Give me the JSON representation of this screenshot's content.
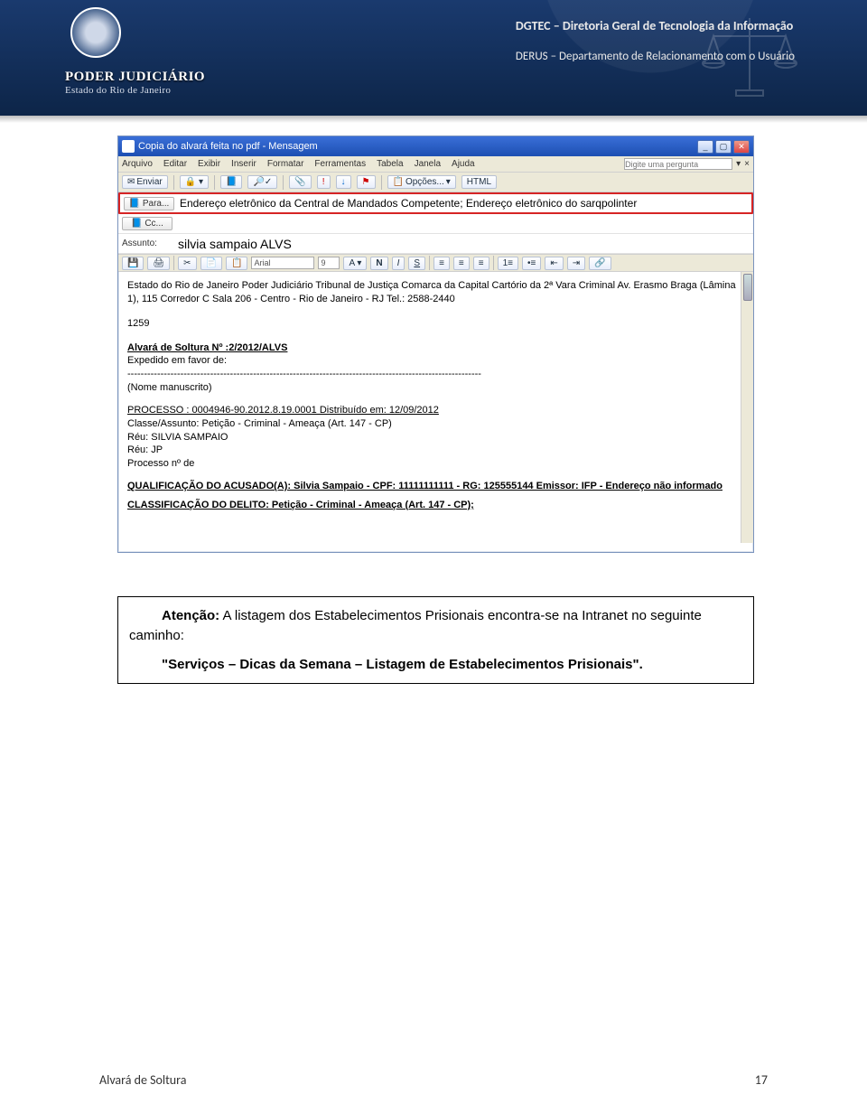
{
  "header": {
    "org_line1": "PODER JUDICIÁRIO",
    "org_line2": "Estado do Rio de Janeiro",
    "right1": "DGTEC – Diretoria Geral de Tecnologia da  Informação",
    "right2": "DERUS – Departamento de Relacionamento com o Usuário"
  },
  "email": {
    "title": "Copia do alvará feita no pdf - Mensagem",
    "menus": [
      "Arquivo",
      "Editar",
      "Exibir",
      "Inserir",
      "Formatar",
      "Ferramentas",
      "Tabela",
      "Janela",
      "Ajuda"
    ],
    "question_placeholder": "Digite uma pergunta",
    "toolbar": {
      "send": "Enviar",
      "options": "Opções...",
      "html": "HTML"
    },
    "fields": {
      "para_label": "Para...",
      "para_value": "Endereço eletrônico da Central de Mandados Competente; Endereço eletrônico do sarqpolinter",
      "cc_label": "Cc...",
      "cc_value": "",
      "assunto_label": "Assunto:",
      "assunto_value": "silvia sampaio ALVS"
    },
    "format": {
      "font": "Arial",
      "size": "9"
    },
    "body": {
      "line_org": "Estado do Rio de Janeiro Poder Judiciário Tribunal de Justiça Comarca da Capital Cartório da 2ª Vara Criminal Av. Erasmo Braga (Lâmina 1), 115 Corredor C Sala 206 - Centro - Rio de Janeiro - RJ Tel.: 2588-2440",
      "num": "1259",
      "alvara_title": "Alvará de Soltura Nº :2/2012/ALVS",
      "expedido": "Expedido em favor de:",
      "dashes": "-----------------------------------------------------------------------------------------------------------",
      "nome": "(Nome manuscrito)",
      "processo": "PROCESSO : 0004946-90.2012.8.19.0001 Distribuído em: 12/09/2012",
      "classe": "Classe/Assunto: Petição - Criminal - Ameaça (Art. 147 - CP)",
      "reu1": "Réu: SILVIA SAMPAIO",
      "reu2": "Réu: JP",
      "procnum": "Processo nº de",
      "qualif": "QUALIFICAÇÃO DO ACUSADO(A): Silvia Sampaio - CPF: 11111111111 - RG: 125555144 Emissor: IFP - Endereço não informado",
      "classif": "CLASSIFICAÇÃO DO DELITO: Petição - Criminal - Ameaça (Art. 147 - CP);"
    }
  },
  "attention": {
    "line1_bold": "Atenção:",
    "line1_rest": " A listagem dos Estabelecimentos Prisionais encontra-se na Intranet no seguinte caminho:",
    "line2_bold": "\"Serviços – Dicas da Semana – Listagem de Estabelecimentos Prisionais\"."
  },
  "footer": {
    "left": "Alvará de Soltura",
    "right": "17"
  }
}
